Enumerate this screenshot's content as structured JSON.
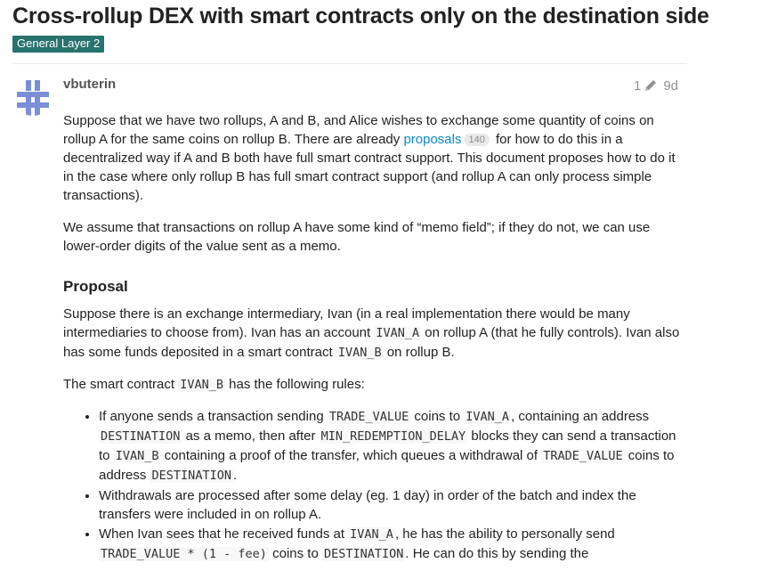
{
  "topic": {
    "title": "Cross-rollup DEX with smart contracts only on the destination side",
    "category": "General Layer 2"
  },
  "post": {
    "username": "vbuterin",
    "edit_count": "1",
    "age": "9d",
    "p1": {
      "a": "Suppose that we have two rollups, A and B, and Alice wishes to exchange some quantity of coins on rollup A for the same coins on rollup B. There are already ",
      "link": "proposals",
      "link_clicks": "140",
      "b": " for how to do this in a decentralized way if A and B both have full smart contract support. This document proposes how to do it in the case where only rollup B has full smart contract support (and rollup A can only process simple transactions)."
    },
    "p2": "We assume that transactions on rollup A have some kind of “memo field”; if they do not, we can use lower-order digits of the value sent as a memo.",
    "heading": "Proposal",
    "p3": {
      "a": "Suppose there is an exchange intermediary, Ivan (in a real implementation there would be many intermediaries to choose from). Ivan has an account ",
      "code1": "IVAN_A",
      "b": " on rollup A (that he fully controls). Ivan also has some funds deposited in a smart contract ",
      "code2": "IVAN_B",
      "c": " on rollup B."
    },
    "p4": {
      "a": "The smart contract ",
      "code": "IVAN_B",
      "b": " has the following rules:"
    },
    "rule1": {
      "t1": "If anyone sends a transaction sending ",
      "c1": "TRADE_VALUE",
      "t2": " coins to ",
      "c2": "IVAN_A",
      "t3": ", containing an address ",
      "c3": "DESTINATION",
      "t4": " as a memo, then after ",
      "c4": "MIN_REDEMPTION_DELAY",
      "t5": " blocks they can send a transaction to ",
      "c5": "IVAN_B",
      "t6": " containing a proof of the transfer, which queues a withdrawal of ",
      "c6": "TRADE_VALUE",
      "t7": " coins to address ",
      "c7": "DESTINATION",
      "t8": "."
    },
    "rule2": "Withdrawals are processed after some delay (eg. 1 day) in order of the batch and index the transfers were included in on rollup A.",
    "rule3": {
      "t1": "When Ivan sees that he received funds at ",
      "c1": "IVAN_A",
      "t2": ", he has the ability to personally send ",
      "c2": "TRADE_VALUE * (1 - fee)",
      "t3": " coins to ",
      "c3": "DESTINATION",
      "t4": ". He can do this by sending the"
    }
  },
  "colors": {
    "category": "#27736d",
    "link": "#0a8ac9",
    "avatar": "#7b8fd6"
  },
  "icons": {
    "avatar": "avatar-identicon",
    "edit": "pencil-icon"
  }
}
